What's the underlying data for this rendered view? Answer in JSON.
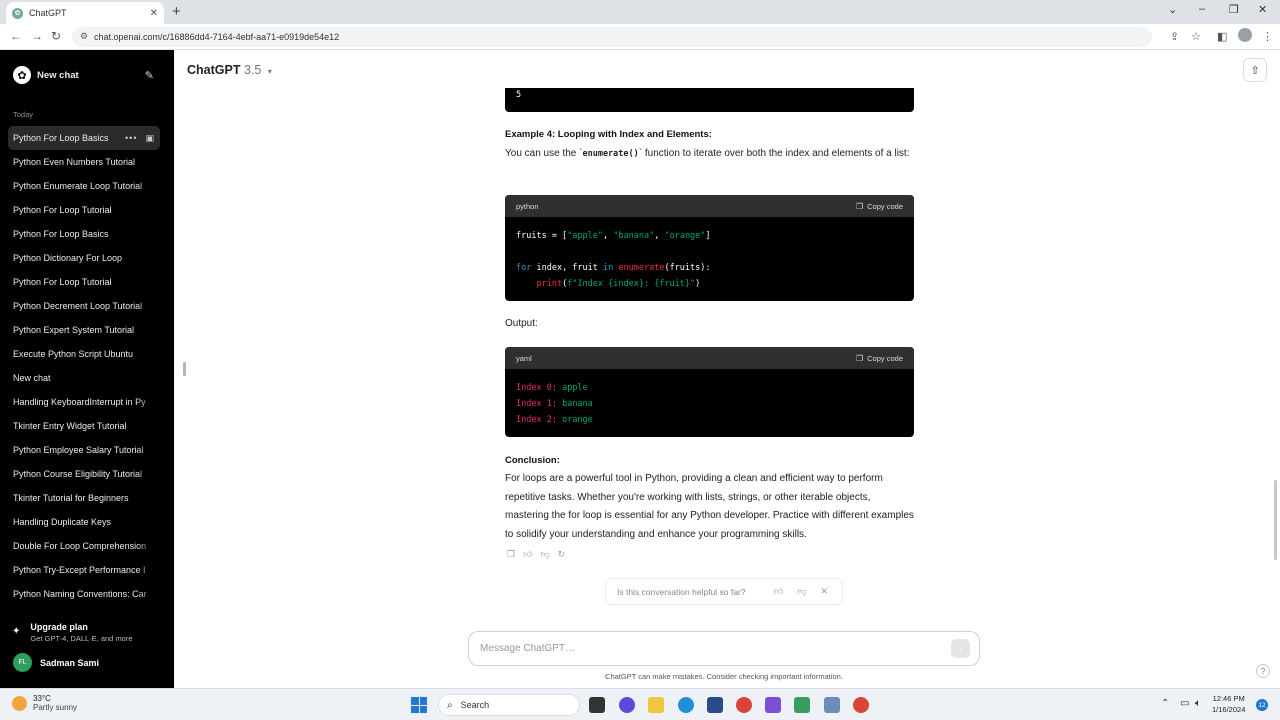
{
  "browser": {
    "tab_title": "ChatGPT",
    "url": "chat.openai.com/c/16886dd4-7164-4ebf-aa71-e0919de54e12"
  },
  "sidebar": {
    "new_chat_label": "New chat",
    "section_label": "Today",
    "items": [
      {
        "label": "Python For Loop Basics"
      },
      {
        "label": "Python Even Numbers Tutorial"
      },
      {
        "label": "Python Enumerate Loop Tutorial"
      },
      {
        "label": "Python For Loop Tutorial"
      },
      {
        "label": "Python For Loop Basics"
      },
      {
        "label": "Python Dictionary For Loop"
      },
      {
        "label": "Python For Loop Tutorial"
      },
      {
        "label": "Python Decrement Loop Tutorial"
      },
      {
        "label": "Python Expert System Tutorial"
      },
      {
        "label": "Execute Python Script Ubuntu"
      },
      {
        "label": "New chat"
      },
      {
        "label": "Handling KeyboardInterrupt in Py"
      },
      {
        "label": "Tkinter Entry Widget Tutorial"
      },
      {
        "label": "Python Employee Salary Tutorial"
      },
      {
        "label": "Python Course Eligibility Tutorial"
      },
      {
        "label": "Tkinter Tutorial for Beginners"
      },
      {
        "label": "Handling Duplicate Keys"
      },
      {
        "label": "Double For Loop Comprehension"
      },
      {
        "label": "Python Try-Except Performance I"
      },
      {
        "label": "Python Naming Conventions: Car"
      }
    ],
    "upgrade_title": "Upgrade plan",
    "upgrade_sub": "Get GPT-4, DALL·E, and more",
    "user_initials": "FL",
    "user_name": "Sadman Sami"
  },
  "header": {
    "model_name": "ChatGPT",
    "model_version": "3.5"
  },
  "message": {
    "prev_output_tail": "5",
    "example4_title": "Example 4: Looping with Index and Elements:",
    "example4_text_before": "You can use the `",
    "example4_code": "enumerate()",
    "example4_text_after": "` function to iterate over both the index and elements of a list:",
    "code1_lang": "python",
    "copy_label": "Copy code",
    "output_label": "Output:",
    "code2_lang": "yaml",
    "code2_lines": [
      {
        "key": "Index 0:",
        "val": "apple"
      },
      {
        "key": "Index 1:",
        "val": "banana"
      },
      {
        "key": "Index 2:",
        "val": "orange"
      }
    ],
    "conclusion_title": "Conclusion:",
    "conclusion_text": "For loops are a powerful tool in Python, providing a clean and efficient way to perform repetitive tasks. Whether you're working with lists, strings, or other iterable objects, mastering the for loop is essential for any Python developer. Practice with different examples to solidify your understanding and enhance your programming skills."
  },
  "feedback": {
    "question": "Is this conversation helpful so far?"
  },
  "composer": {
    "placeholder": "Message ChatGPT…",
    "disclaimer": "ChatGPT can make mistakes. Consider checking important information."
  },
  "taskbar": {
    "temp": "33°C",
    "weather_desc": "Partly sunny",
    "search_label": "Search",
    "time": "12:46 PM",
    "date": "1/16/2024",
    "notification_count": "12"
  }
}
